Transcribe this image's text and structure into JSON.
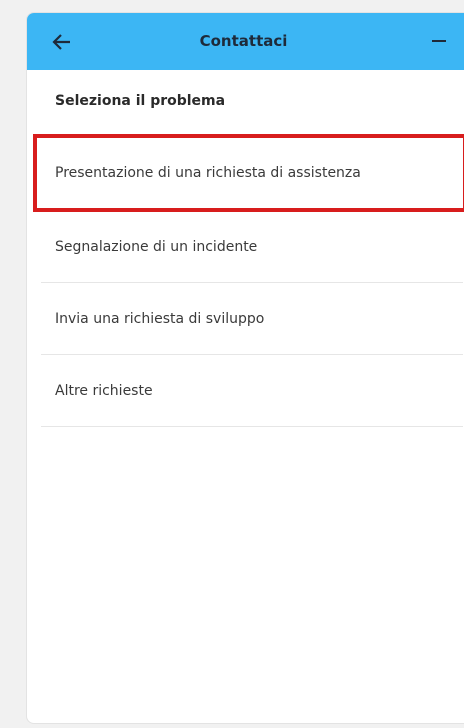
{
  "header": {
    "title": "Contattaci",
    "back_icon": "arrow-left-icon",
    "minimize_icon": "minus-icon",
    "background_color": "#3cb6f4"
  },
  "section": {
    "heading": "Seleziona il problema"
  },
  "options": [
    {
      "label": "Presentazione di una richiesta di assistenza",
      "highlighted": true
    },
    {
      "label": "Segnalazione di un incidente",
      "highlighted": false
    },
    {
      "label": "Invia una richiesta di sviluppo",
      "highlighted": false
    },
    {
      "label": "Altre richieste",
      "highlighted": false
    }
  ],
  "colors": {
    "highlight_border": "#d81d1d",
    "divider": "#e6e6e6"
  }
}
